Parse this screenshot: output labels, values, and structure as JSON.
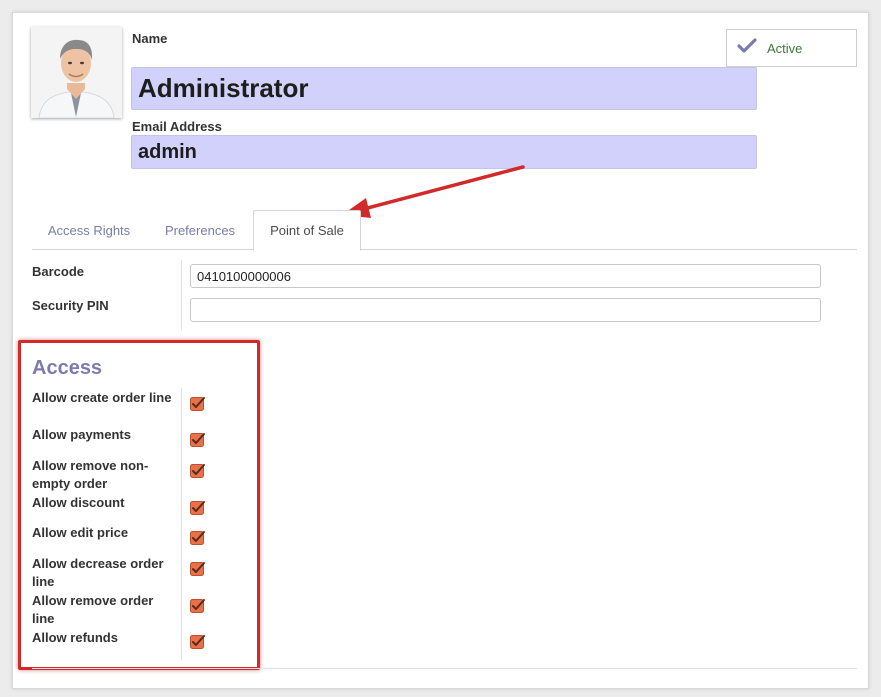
{
  "header": {
    "name_label": "Name",
    "name_value": "Administrator",
    "email_label": "Email Address",
    "email_value": "admin",
    "status_label": "Active"
  },
  "tabs": [
    {
      "label": "Access Rights",
      "active": false
    },
    {
      "label": "Preferences",
      "active": false
    },
    {
      "label": "Point of Sale",
      "active": true
    }
  ],
  "pos": {
    "barcode_label": "Barcode",
    "barcode_value": "0410100000006",
    "pin_label": "Security PIN",
    "pin_value": ""
  },
  "access": {
    "title": "Access",
    "permissions": [
      {
        "label": "Allow create order line",
        "checked": true
      },
      {
        "label": "Allow payments",
        "checked": true
      },
      {
        "label": "Allow remove non-empty order",
        "checked": true
      },
      {
        "label": "Allow discount",
        "checked": true
      },
      {
        "label": "Allow edit price",
        "checked": true
      },
      {
        "label": "Allow decrease order line",
        "checked": true
      },
      {
        "label": "Allow remove order line",
        "checked": true
      },
      {
        "label": "Allow refunds",
        "checked": true
      }
    ]
  },
  "colors": {
    "accent": "#7c7bad",
    "input_highlight": "#d1d1fb",
    "checkbox": "#e8714a",
    "annotation_red": "#d12a2a"
  },
  "icons": {
    "status": "check-icon",
    "checkbox": "checkbox-checked-icon"
  }
}
